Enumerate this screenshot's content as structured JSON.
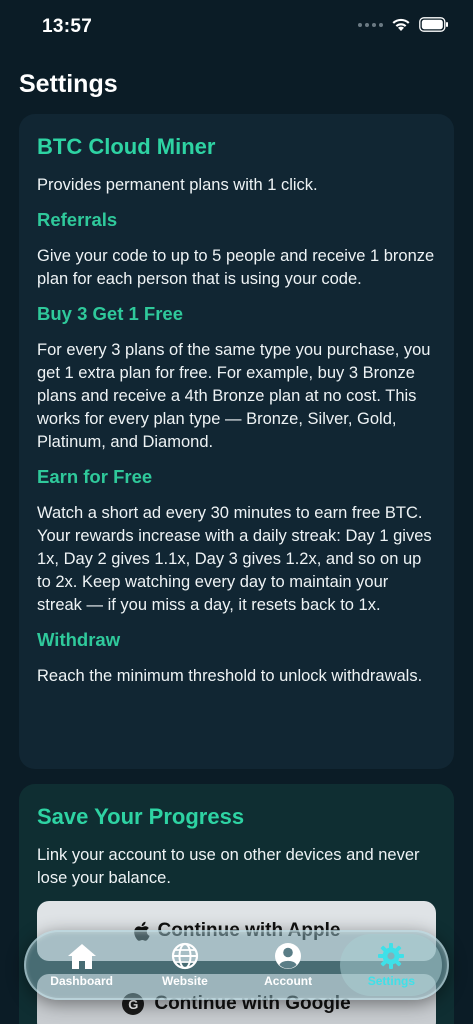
{
  "status": {
    "time": "13:57"
  },
  "page": {
    "title": "Settings"
  },
  "info_card": {
    "title": "BTC Cloud Miner",
    "intro": "Provides permanent plans with 1 click.",
    "sections": [
      {
        "title": "Referrals",
        "text": "Give your code to up to 5 people and receive 1 bronze plan for each person that is using your code."
      },
      {
        "title": "Buy 3 Get 1 Free",
        "text": "For every 3 plans of the same type you purchase, you get 1 extra plan for free. For example, buy 3 Bronze plans and receive a 4th Bronze plan at no cost. This works for every plan type — Bronze, Silver, Gold, Platinum, and Diamond."
      },
      {
        "title": "Earn for Free",
        "text": "Watch a short ad every 30 minutes to earn free BTC. Your rewards increase with a daily streak: Day 1 gives 1x, Day 2 gives 1.1x, Day 3 gives 1.2x, and so on up to 2x. Keep watching every day to maintain your streak — if you miss a day, it resets back to 1x."
      },
      {
        "title": "Withdraw",
        "text": "Reach the minimum threshold to unlock withdrawals."
      }
    ]
  },
  "save_card": {
    "title": "Save Your Progress",
    "text": "Link your account to use on other devices and never lose your balance.",
    "apple_button": "Continue with Apple",
    "google_button": "Continue with Google"
  },
  "tabs": [
    {
      "label": "Dashboard",
      "icon": "house-icon"
    },
    {
      "label": "Website",
      "icon": "globe-icon"
    },
    {
      "label": "Account",
      "icon": "person-icon"
    },
    {
      "label": "Settings",
      "icon": "gear-icon",
      "active": true
    }
  ],
  "colors": {
    "accent": "#2ed3a3",
    "background": "#0b1c26",
    "card": "#112633",
    "active_tab": "#3fe0e8"
  }
}
